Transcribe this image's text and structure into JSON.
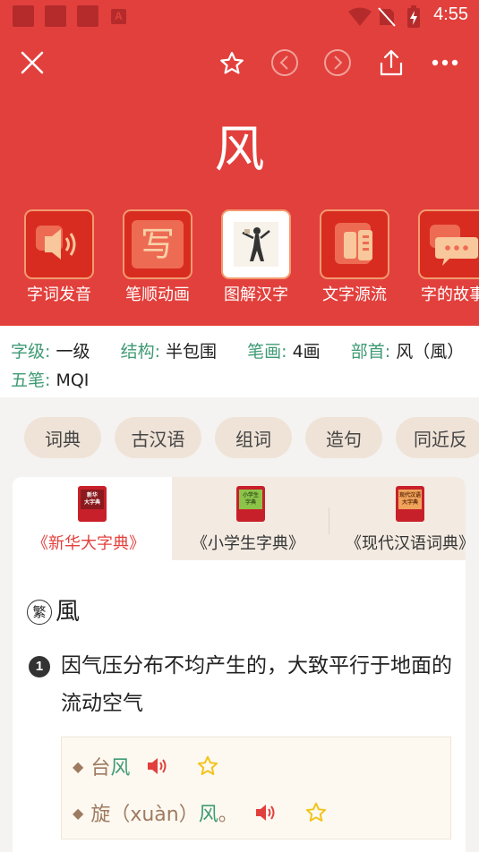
{
  "status_bar": {
    "time": "4:55",
    "app_badge": "A"
  },
  "toolbar": {
    "close_icon": "close-icon",
    "favorite_icon": "star-outline-icon",
    "prev_icon": "chevron-left-circle-icon",
    "next_icon": "chevron-right-circle-icon",
    "share_icon": "share-icon",
    "more_icon": "more-dots-icon"
  },
  "character": "风",
  "features": [
    {
      "label": "字词发音",
      "icon": "speaker-icon"
    },
    {
      "label": "笔顺动画",
      "icon": "write-icon",
      "glyph": "写"
    },
    {
      "label": "图解汉字",
      "icon": "picture-icon"
    },
    {
      "label": "文字源流",
      "icon": "book-icon"
    },
    {
      "label": "字的故事",
      "icon": "chat-bubble-icon"
    }
  ],
  "info": {
    "level_key": "字级:",
    "level_val": "一级",
    "structure_key": "结构:",
    "structure_val": "半包围",
    "strokes_key": "笔画:",
    "strokes_val": "4画",
    "radical_key": "部首:",
    "radical_val": "风（風）",
    "wubi_key": "五笔:",
    "wubi_val": "MQI"
  },
  "pills": [
    "词典",
    "古汉语",
    "组词",
    "造句",
    "同近反"
  ],
  "tabs": [
    {
      "label": "《新华大字典》",
      "cover": "新华\n大字典",
      "active": true
    },
    {
      "label": "《小学生字典》",
      "cover": "小学生\n字典",
      "active": false
    },
    {
      "label": "《现代汉语词典》",
      "cover": "现代汉语\n大字典",
      "active": false
    }
  ],
  "definition": {
    "traditional_mark": "繁",
    "traditional": "風",
    "number": "1",
    "text": "因气压分布不均产生的，大致平行于地面的流动空气",
    "examples": [
      {
        "prefix": "台",
        "highlight": "风",
        "suffix": ""
      },
      {
        "prefix": "旋（xuàn）",
        "highlight": "风",
        "suffix": "。"
      }
    ]
  },
  "colors": {
    "header_red": "#e2403c",
    "tile_red": "#d92c20",
    "accent_green": "#3f9a74",
    "pill_bg": "#efe3d8",
    "tab_active_text": "#e2403c",
    "example_brown": "#9e7b60",
    "star_yellow": "#f2c318",
    "speaker_red": "#e2403c"
  }
}
